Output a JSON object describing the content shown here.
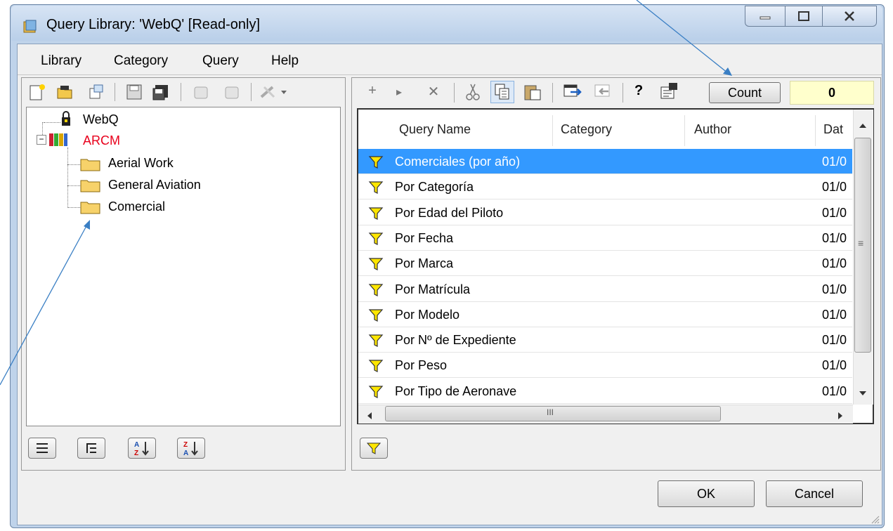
{
  "window": {
    "title": "Query Library: 'WebQ' [Read-only]"
  },
  "menu": {
    "items": [
      "Library",
      "Category",
      "Query",
      "Help"
    ]
  },
  "tree": {
    "root": "WebQ",
    "library": "ARCM",
    "categories": [
      "Aerial Work",
      "General Aviation",
      "Comercial"
    ]
  },
  "toolbar": {
    "count_label": "Count",
    "count_value": "0",
    "add_glyph": "+",
    "next_glyph": "▸",
    "delete_glyph": "✕",
    "help_glyph": "?"
  },
  "grid": {
    "columns": [
      "Query Name",
      "Category",
      "Author",
      "Dat"
    ],
    "rows": [
      {
        "name": "Comerciales (por año)",
        "date": "01/0",
        "selected": true
      },
      {
        "name": "Por Categoría",
        "date": "01/0"
      },
      {
        "name": "Por Edad del Piloto",
        "date": "01/0"
      },
      {
        "name": "Por Fecha",
        "date": "01/0"
      },
      {
        "name": "Por Marca",
        "date": "01/0"
      },
      {
        "name": "Por Matrícula",
        "date": "01/0"
      },
      {
        "name": "Por Modelo",
        "date": "01/0"
      },
      {
        "name": "Por Nº de Expediente",
        "date": "01/0"
      },
      {
        "name": "Por Peso",
        "date": "01/0"
      },
      {
        "name": "Por Tipo de Aeronave",
        "date": "01/0"
      }
    ],
    "hscroll_glyph": "III",
    "vscroll_glyph": "≡"
  },
  "buttons": {
    "ok": "OK",
    "cancel": "Cancel"
  },
  "colors": {
    "selection": "#3399ff",
    "library_text": "#e8001c",
    "count_bg": "#ffffcc"
  }
}
